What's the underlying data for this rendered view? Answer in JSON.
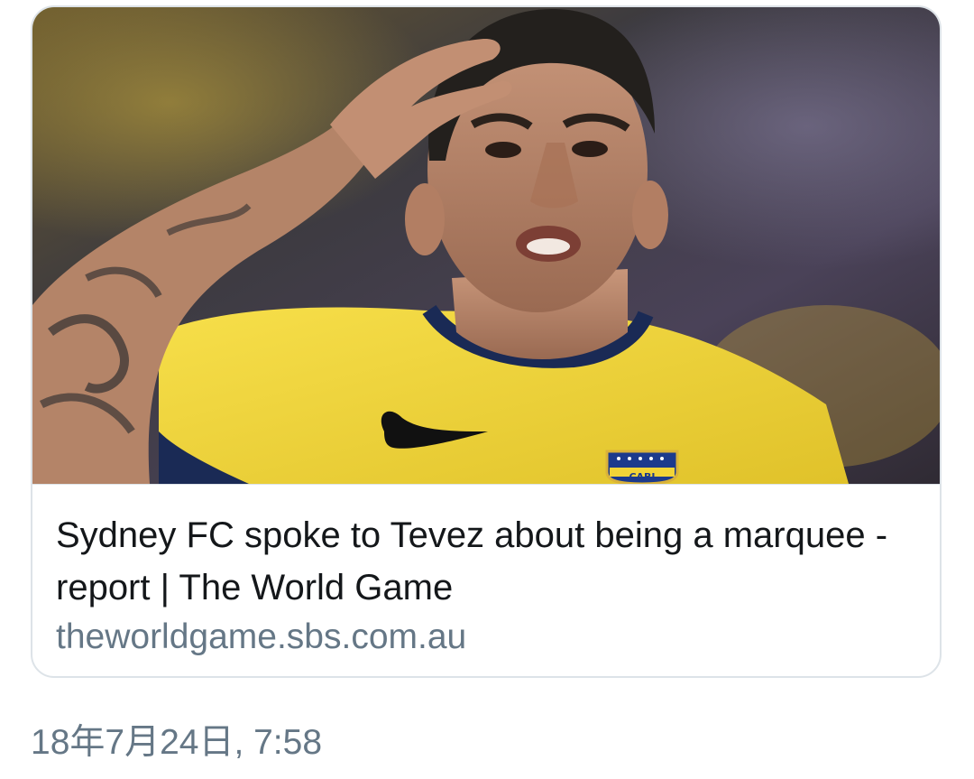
{
  "link_card": {
    "title": "Sydney FC spoke to Tevez about being a marquee - report | The World Game",
    "domain": "theworldgame.sbs.com.au",
    "image": {
      "subject": "footballer-in-yellow-jersey-saluting",
      "badge_text": "CABJ"
    }
  },
  "tweet": {
    "timestamp": "18年7月24日, 7:58"
  },
  "colors": {
    "title_text": "#14171a",
    "secondary_text": "#657786",
    "card_border": "#dde3e8",
    "jersey_yellow": "#f2d437",
    "badge_blue": "#1c3a8c"
  }
}
